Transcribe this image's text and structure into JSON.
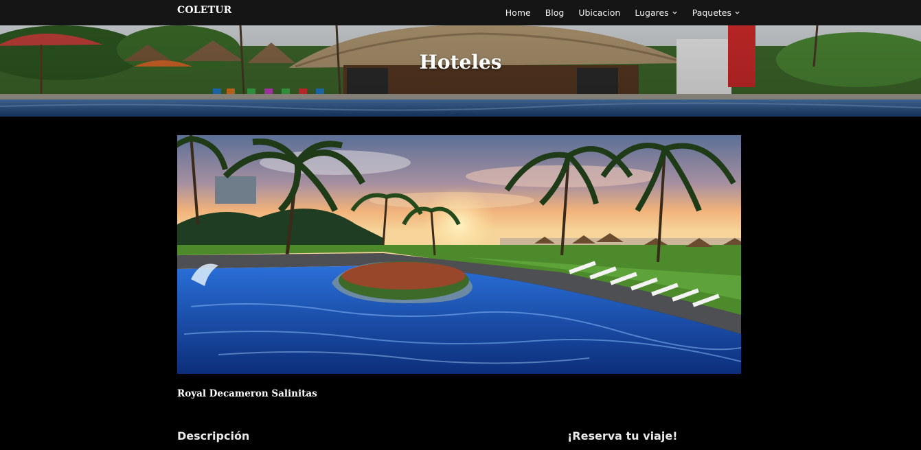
{
  "navbar": {
    "brand": "COLETUR",
    "links": [
      {
        "label": "Home",
        "has_dropdown": false
      },
      {
        "label": "Blog",
        "has_dropdown": false
      },
      {
        "label": "Ubicacion",
        "has_dropdown": false
      },
      {
        "label": "Lugares",
        "has_dropdown": true,
        "icon": "chevron-down-icon"
      },
      {
        "label": "Paquetes",
        "has_dropdown": true,
        "icon": "chevron-down-icon"
      }
    ]
  },
  "hero": {
    "title": "Hoteles"
  },
  "hotel": {
    "name": "Royal Decameron Salinitas"
  },
  "sections": {
    "description_heading": "Descripción",
    "reserve_heading": "¡Reserva tu viaje!"
  },
  "colors": {
    "navbar_bg": "#151515",
    "page_bg": "#000000",
    "text": "#ffffff",
    "pool_blue": "#1f5fc4"
  }
}
